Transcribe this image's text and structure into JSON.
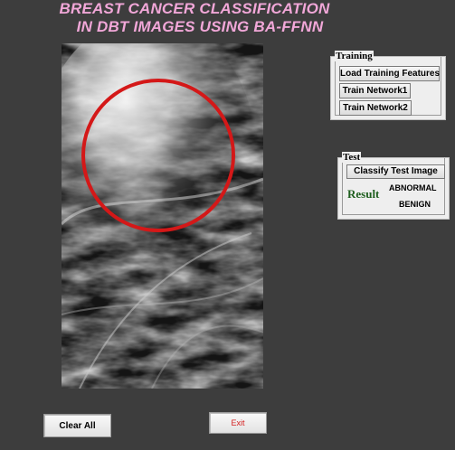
{
  "title": {
    "line1": "BREAST CANCER CLASSIFICATION",
    "line2": "IN DBT IMAGES USING BA-FFNN"
  },
  "image_panel": {
    "icon": "mammogram-image",
    "highlight_color": "#d41818"
  },
  "training": {
    "legend": "Training",
    "buttons": [
      "Load Training Features",
      "Train Network1",
      "Train Network2"
    ]
  },
  "test": {
    "legend": "Test",
    "classify_button": "Classify Test Image",
    "result_label": "Result",
    "result_line1": "ABNORMAL",
    "result_line2": "BENIGN"
  },
  "footer": {
    "clear_label": "Clear All",
    "exit_label": "Exit",
    "exit_color": "#d42020"
  },
  "colors": {
    "background": "#3d3d3d",
    "title": "#f1a7d8"
  }
}
